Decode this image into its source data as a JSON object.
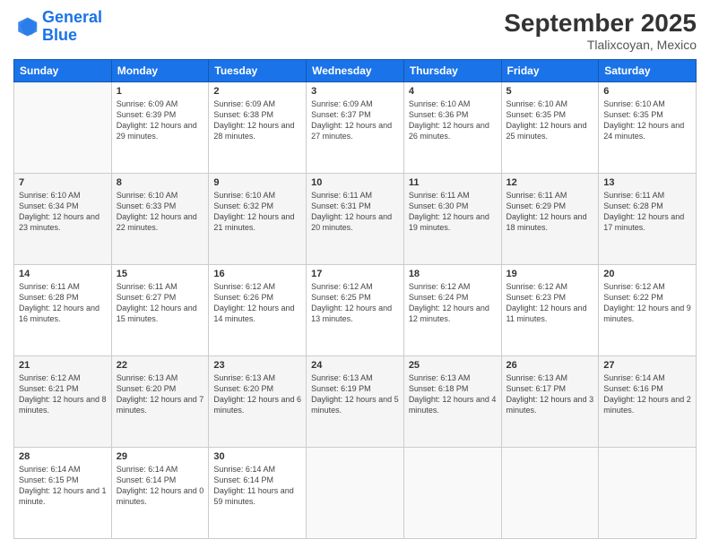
{
  "logo": {
    "line1": "General",
    "line2": "Blue"
  },
  "title": "September 2025",
  "location": "Tlalixcoyan, Mexico",
  "weekdays": [
    "Sunday",
    "Monday",
    "Tuesday",
    "Wednesday",
    "Thursday",
    "Friday",
    "Saturday"
  ],
  "weeks": [
    [
      {
        "day": "",
        "sunrise": "",
        "sunset": "",
        "daylight": ""
      },
      {
        "day": "1",
        "sunrise": "Sunrise: 6:09 AM",
        "sunset": "Sunset: 6:39 PM",
        "daylight": "Daylight: 12 hours and 29 minutes."
      },
      {
        "day": "2",
        "sunrise": "Sunrise: 6:09 AM",
        "sunset": "Sunset: 6:38 PM",
        "daylight": "Daylight: 12 hours and 28 minutes."
      },
      {
        "day": "3",
        "sunrise": "Sunrise: 6:09 AM",
        "sunset": "Sunset: 6:37 PM",
        "daylight": "Daylight: 12 hours and 27 minutes."
      },
      {
        "day": "4",
        "sunrise": "Sunrise: 6:10 AM",
        "sunset": "Sunset: 6:36 PM",
        "daylight": "Daylight: 12 hours and 26 minutes."
      },
      {
        "day": "5",
        "sunrise": "Sunrise: 6:10 AM",
        "sunset": "Sunset: 6:35 PM",
        "daylight": "Daylight: 12 hours and 25 minutes."
      },
      {
        "day": "6",
        "sunrise": "Sunrise: 6:10 AM",
        "sunset": "Sunset: 6:35 PM",
        "daylight": "Daylight: 12 hours and 24 minutes."
      }
    ],
    [
      {
        "day": "7",
        "sunrise": "Sunrise: 6:10 AM",
        "sunset": "Sunset: 6:34 PM",
        "daylight": "Daylight: 12 hours and 23 minutes."
      },
      {
        "day": "8",
        "sunrise": "Sunrise: 6:10 AM",
        "sunset": "Sunset: 6:33 PM",
        "daylight": "Daylight: 12 hours and 22 minutes."
      },
      {
        "day": "9",
        "sunrise": "Sunrise: 6:10 AM",
        "sunset": "Sunset: 6:32 PM",
        "daylight": "Daylight: 12 hours and 21 minutes."
      },
      {
        "day": "10",
        "sunrise": "Sunrise: 6:11 AM",
        "sunset": "Sunset: 6:31 PM",
        "daylight": "Daylight: 12 hours and 20 minutes."
      },
      {
        "day": "11",
        "sunrise": "Sunrise: 6:11 AM",
        "sunset": "Sunset: 6:30 PM",
        "daylight": "Daylight: 12 hours and 19 minutes."
      },
      {
        "day": "12",
        "sunrise": "Sunrise: 6:11 AM",
        "sunset": "Sunset: 6:29 PM",
        "daylight": "Daylight: 12 hours and 18 minutes."
      },
      {
        "day": "13",
        "sunrise": "Sunrise: 6:11 AM",
        "sunset": "Sunset: 6:28 PM",
        "daylight": "Daylight: 12 hours and 17 minutes."
      }
    ],
    [
      {
        "day": "14",
        "sunrise": "Sunrise: 6:11 AM",
        "sunset": "Sunset: 6:28 PM",
        "daylight": "Daylight: 12 hours and 16 minutes."
      },
      {
        "day": "15",
        "sunrise": "Sunrise: 6:11 AM",
        "sunset": "Sunset: 6:27 PM",
        "daylight": "Daylight: 12 hours and 15 minutes."
      },
      {
        "day": "16",
        "sunrise": "Sunrise: 6:12 AM",
        "sunset": "Sunset: 6:26 PM",
        "daylight": "Daylight: 12 hours and 14 minutes."
      },
      {
        "day": "17",
        "sunrise": "Sunrise: 6:12 AM",
        "sunset": "Sunset: 6:25 PM",
        "daylight": "Daylight: 12 hours and 13 minutes."
      },
      {
        "day": "18",
        "sunrise": "Sunrise: 6:12 AM",
        "sunset": "Sunset: 6:24 PM",
        "daylight": "Daylight: 12 hours and 12 minutes."
      },
      {
        "day": "19",
        "sunrise": "Sunrise: 6:12 AM",
        "sunset": "Sunset: 6:23 PM",
        "daylight": "Daylight: 12 hours and 11 minutes."
      },
      {
        "day": "20",
        "sunrise": "Sunrise: 6:12 AM",
        "sunset": "Sunset: 6:22 PM",
        "daylight": "Daylight: 12 hours and 9 minutes."
      }
    ],
    [
      {
        "day": "21",
        "sunrise": "Sunrise: 6:12 AM",
        "sunset": "Sunset: 6:21 PM",
        "daylight": "Daylight: 12 hours and 8 minutes."
      },
      {
        "day": "22",
        "sunrise": "Sunrise: 6:13 AM",
        "sunset": "Sunset: 6:20 PM",
        "daylight": "Daylight: 12 hours and 7 minutes."
      },
      {
        "day": "23",
        "sunrise": "Sunrise: 6:13 AM",
        "sunset": "Sunset: 6:20 PM",
        "daylight": "Daylight: 12 hours and 6 minutes."
      },
      {
        "day": "24",
        "sunrise": "Sunrise: 6:13 AM",
        "sunset": "Sunset: 6:19 PM",
        "daylight": "Daylight: 12 hours and 5 minutes."
      },
      {
        "day": "25",
        "sunrise": "Sunrise: 6:13 AM",
        "sunset": "Sunset: 6:18 PM",
        "daylight": "Daylight: 12 hours and 4 minutes."
      },
      {
        "day": "26",
        "sunrise": "Sunrise: 6:13 AM",
        "sunset": "Sunset: 6:17 PM",
        "daylight": "Daylight: 12 hours and 3 minutes."
      },
      {
        "day": "27",
        "sunrise": "Sunrise: 6:14 AM",
        "sunset": "Sunset: 6:16 PM",
        "daylight": "Daylight: 12 hours and 2 minutes."
      }
    ],
    [
      {
        "day": "28",
        "sunrise": "Sunrise: 6:14 AM",
        "sunset": "Sunset: 6:15 PM",
        "daylight": "Daylight: 12 hours and 1 minute."
      },
      {
        "day": "29",
        "sunrise": "Sunrise: 6:14 AM",
        "sunset": "Sunset: 6:14 PM",
        "daylight": "Daylight: 12 hours and 0 minutes."
      },
      {
        "day": "30",
        "sunrise": "Sunrise: 6:14 AM",
        "sunset": "Sunset: 6:14 PM",
        "daylight": "Daylight: 11 hours and 59 minutes."
      },
      {
        "day": "",
        "sunrise": "",
        "sunset": "",
        "daylight": ""
      },
      {
        "day": "",
        "sunrise": "",
        "sunset": "",
        "daylight": ""
      },
      {
        "day": "",
        "sunrise": "",
        "sunset": "",
        "daylight": ""
      },
      {
        "day": "",
        "sunrise": "",
        "sunset": "",
        "daylight": ""
      }
    ]
  ]
}
